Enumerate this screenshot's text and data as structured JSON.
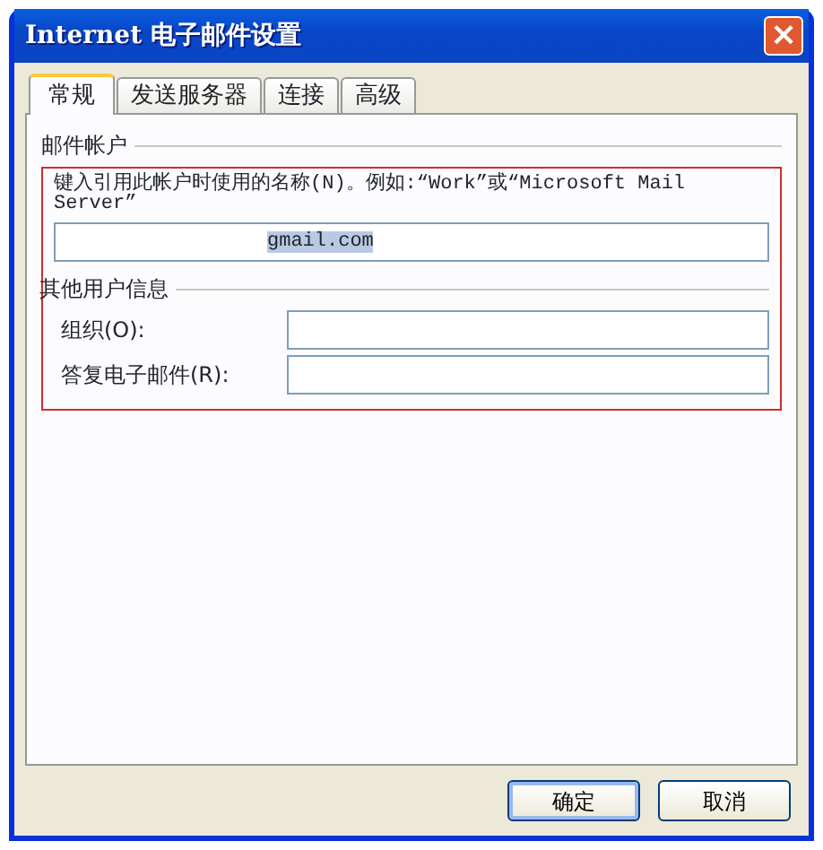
{
  "window": {
    "title": "Internet 电子邮件设置",
    "close": "×"
  },
  "tabs": [
    {
      "label": "常规",
      "selected": true
    },
    {
      "label": "发送服务器",
      "selected": false
    },
    {
      "label": "连接",
      "selected": false
    },
    {
      "label": "高级",
      "selected": false
    }
  ],
  "account": {
    "heading": "邮件帐户",
    "hint": "键入引用此帐户时使用的名称(N)。例如:“Work”或“Microsoft Mail Server”",
    "value": "gmail.com",
    "value_selected": true
  },
  "user_info": {
    "heading": "其他用户信息",
    "fields": [
      {
        "label": "组织(O):"
      },
      {
        "label": "答复电子邮件(R):"
      }
    ]
  },
  "buttons": [
    {
      "label": "确定",
      "default": true
    },
    {
      "label": "取消",
      "default": false
    }
  ]
}
